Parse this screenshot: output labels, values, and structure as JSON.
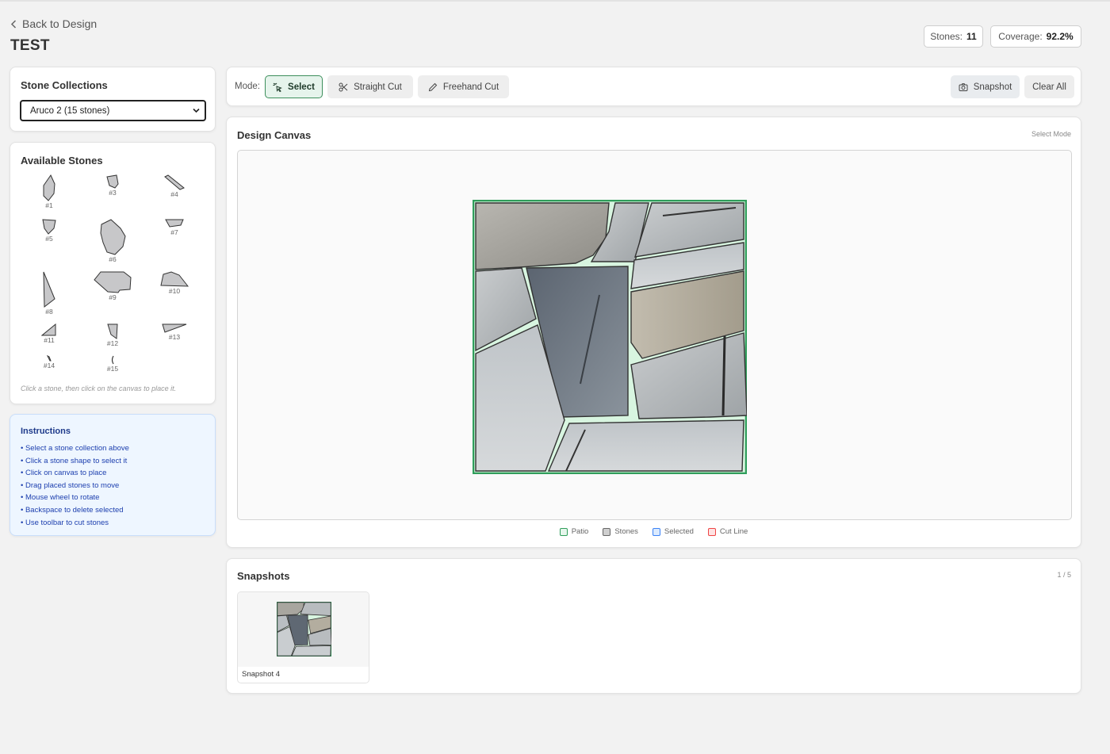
{
  "header": {
    "back_label": "Back to Design",
    "title": "TEST",
    "stones_label": "Stones:",
    "stones_value": "11",
    "coverage_label": "Coverage:",
    "coverage_value": "92.2%"
  },
  "collections": {
    "title": "Stone Collections",
    "selected": "Aruco 2 (15 stones)"
  },
  "available_stones": {
    "title": "Available Stones",
    "items": [
      {
        "label": "#1",
        "icon": "stone-shape-1"
      },
      {
        "label": "#3",
        "icon": "stone-shape-3"
      },
      {
        "label": "#4",
        "icon": "stone-shape-4"
      },
      {
        "label": "#5",
        "icon": "stone-shape-5"
      },
      {
        "label": "#6",
        "icon": "stone-shape-6"
      },
      {
        "label": "#7",
        "icon": "stone-shape-7"
      },
      {
        "label": "#8",
        "icon": "stone-shape-8"
      },
      {
        "label": "#9",
        "icon": "stone-shape-9"
      },
      {
        "label": "#10",
        "icon": "stone-shape-10"
      },
      {
        "label": "#11",
        "icon": "stone-shape-11"
      },
      {
        "label": "#12",
        "icon": "stone-shape-12"
      },
      {
        "label": "#13",
        "icon": "stone-shape-13"
      },
      {
        "label": "#14",
        "icon": "stone-shape-14"
      },
      {
        "label": "#15",
        "icon": "stone-shape-15"
      }
    ],
    "hint": "Click a stone, then click on the canvas to place it."
  },
  "instructions": {
    "title": "Instructions",
    "items": [
      "Select a stone collection above",
      "Click a stone shape to select it",
      "Click on canvas to place",
      "Drag placed stones to move",
      "Mouse wheel to rotate",
      "Backspace to delete selected",
      "Use toolbar to cut stones"
    ]
  },
  "toolbar": {
    "mode_label": "Mode:",
    "select_label": "Select",
    "straight_cut_label": "Straight Cut",
    "freehand_cut_label": "Freehand Cut",
    "snapshot_label": "Snapshot",
    "clear_all_label": "Clear All"
  },
  "canvas": {
    "title": "Design Canvas",
    "mode_indicator": "Select Mode",
    "legend": [
      {
        "label": "Patio",
        "color": "#2f9e5b"
      },
      {
        "label": "Stones",
        "color": "#666666"
      },
      {
        "label": "Selected",
        "color": "#3b82f6"
      },
      {
        "label": "Cut Line",
        "color": "#ef4444"
      }
    ]
  },
  "snapshots": {
    "title": "Snapshots",
    "count": "1 / 5",
    "items": [
      {
        "label": "Snapshot 4"
      }
    ]
  },
  "colors": {
    "accent_green": "#2f9e5b",
    "patio_fill": "#d8f5e0",
    "instructions_bg": "#eef6ff",
    "instructions_text": "#1e40af"
  }
}
